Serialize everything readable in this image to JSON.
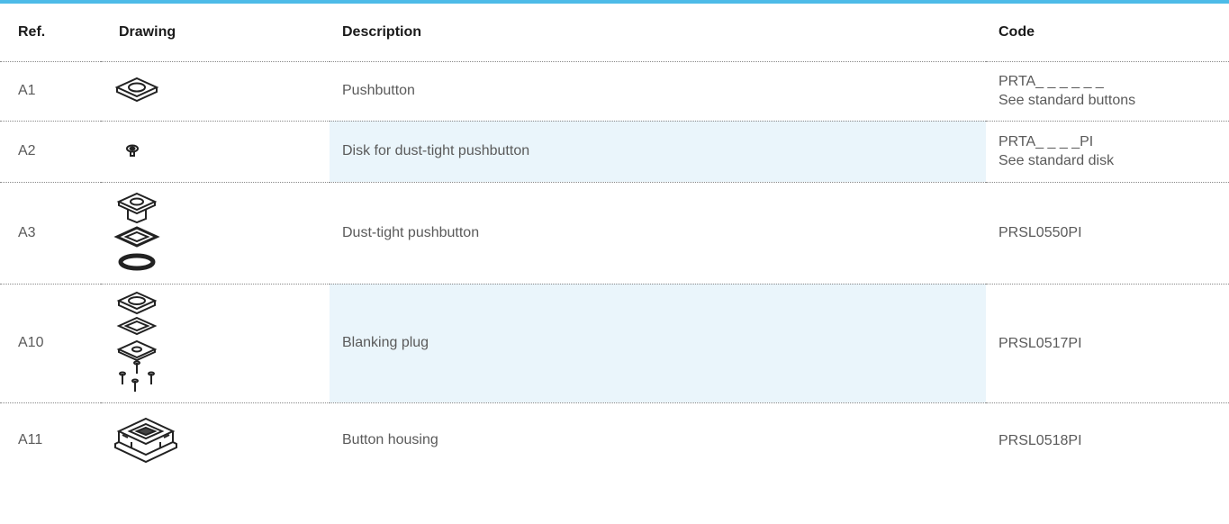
{
  "table": {
    "headers": {
      "ref": "Ref.",
      "drawing": "Drawing",
      "description": "Description",
      "code": "Code"
    },
    "rows": [
      {
        "ref": "A1",
        "description": "Pushbutton",
        "code": "PRTA_ _ _ _ _ _",
        "code_note": "See standard buttons",
        "drawing_icon": "pushbutton-icon"
      },
      {
        "ref": "A2",
        "description": "Disk for dust-tight pushbutton",
        "code": "PRTA_ _ _ _PI",
        "code_note": "See standard disk",
        "drawing_icon": "disk-icon"
      },
      {
        "ref": "A3",
        "description": "Dust-tight pushbutton",
        "code": "PRSL0550PI",
        "drawing_icon": "dust-tight-pushbutton-icon"
      },
      {
        "ref": "A10",
        "description": "Blanking plug",
        "code": "PRSL0517PI",
        "drawing_icon": "blanking-plug-icon"
      },
      {
        "ref": "A11",
        "description": "Button housing",
        "code": "PRSL0518PI",
        "drawing_icon": "button-housing-icon"
      }
    ]
  },
  "colors": {
    "accent_bar": "#4dbbe8",
    "shaded_cell": "#eaf5fb"
  }
}
